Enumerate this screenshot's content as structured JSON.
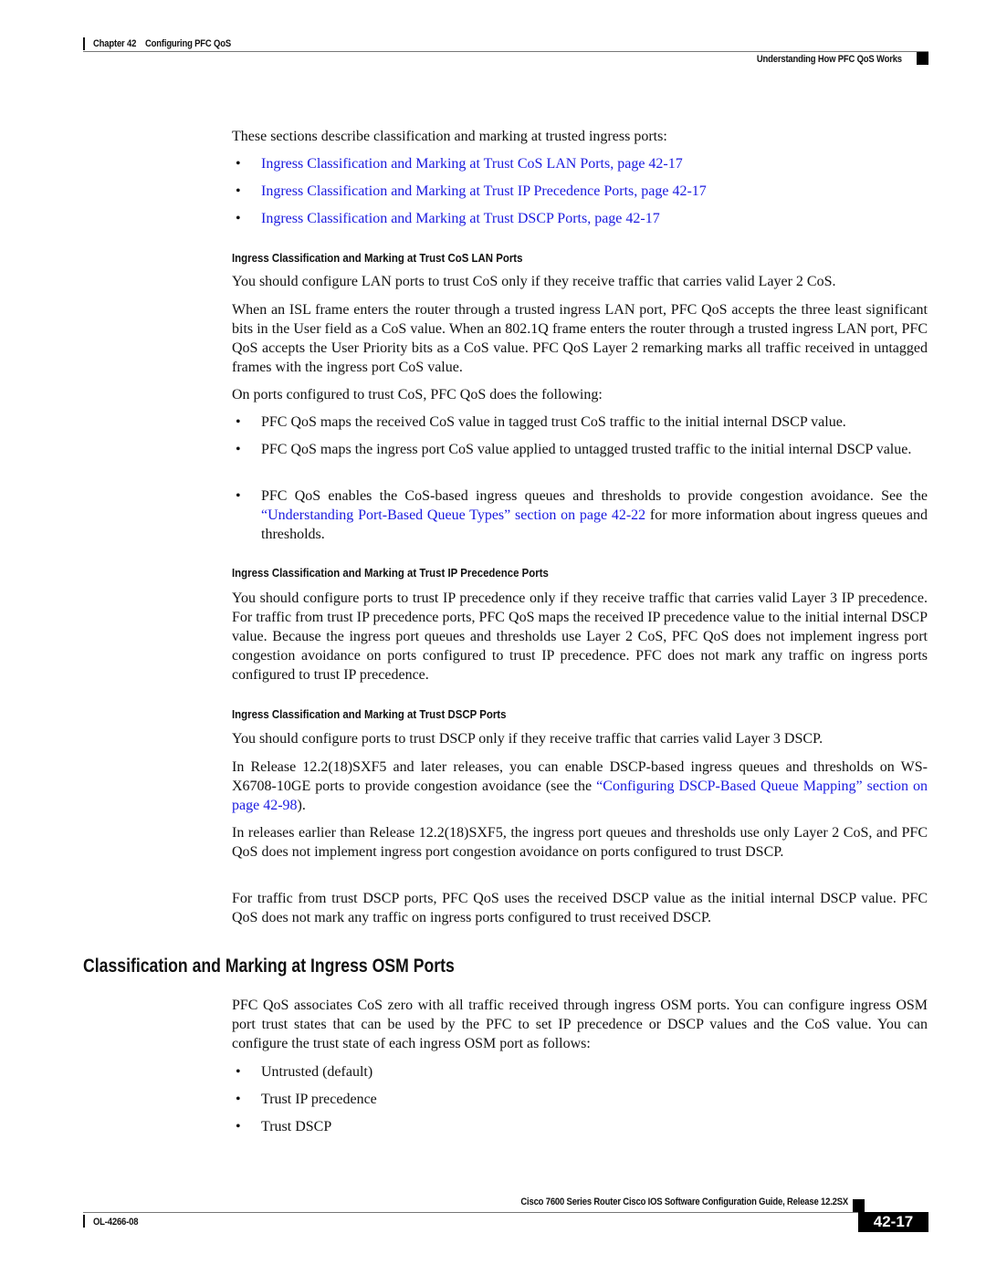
{
  "header": {
    "chapter": "Chapter 42",
    "chapter_title": "Configuring PFC QoS",
    "section": "Understanding How PFC QoS Works"
  },
  "intro": {
    "text": "These sections describe classification and marking at trusted ingress ports:",
    "links": [
      "Ingress Classification and Marking at Trust CoS LAN Ports, page 42-17",
      "Ingress Classification and Marking at Trust IP Precedence Ports, page 42-17",
      "Ingress Classification and Marking at Trust DSCP Ports, page 42-17"
    ]
  },
  "cos": {
    "heading": "Ingress Classification and Marking at Trust CoS LAN Ports",
    "p1": "You should configure LAN ports to trust CoS only if they receive traffic that carries valid Layer 2 CoS.",
    "p2": "When an ISL frame enters the router through a trusted ingress LAN port, PFC QoS accepts the three least significant bits in the User field as a CoS value. When an 802.1Q frame enters the router through a trusted ingress LAN port, PFC QoS accepts the User Priority bits as a CoS value. PFC QoS Layer 2 remarking marks all traffic received in untagged frames with the ingress port CoS value.",
    "p3": "On ports configured to trust CoS, PFC QoS does the following:",
    "bullets": [
      "PFC QoS maps the received CoS value in tagged trust CoS traffic to the initial internal DSCP value.",
      "PFC QoS maps the ingress port CoS value applied to untagged trusted traffic to the initial internal DSCP value."
    ],
    "bullet3_pre": "PFC QoS enables the CoS-based ingress queues and thresholds to provide congestion avoidance. See the ",
    "bullet3_link": "“Understanding Port-Based Queue Types” section on page 42-22",
    "bullet3_post": " for more information about ingress queues and thresholds."
  },
  "ipprec": {
    "heading": "Ingress Classification and Marking at Trust IP Precedence Ports",
    "p1": "You should configure ports to trust IP precedence only if they receive traffic that carries valid Layer 3 IP precedence. For traffic from trust IP precedence ports, PFC QoS maps the received IP precedence value to the initial internal DSCP value. Because the ingress port queues and thresholds use Layer 2 CoS, PFC QoS does not implement ingress port congestion avoidance on ports configured to trust IP precedence. PFC does not mark any traffic on ingress ports configured to trust IP precedence."
  },
  "dscp": {
    "heading": "Ingress Classification and Marking at Trust DSCP Ports",
    "p1": "You should configure ports to trust DSCP only if they receive traffic that carries valid Layer 3 DSCP.",
    "p2_pre": "In Release 12.2(18)SXF5 and later releases, you can enable DSCP-based ingress queues and thresholds on WS-X6708-10GE ports to provide congestion avoidance (see the ",
    "p2_link": "“Configuring DSCP-Based Queue Mapping” section on page 42-98",
    "p2_post": ").",
    "p3": "In releases earlier than Release 12.2(18)SXF5, the ingress port queues and thresholds use only Layer 2 CoS, and PFC QoS does not implement ingress port congestion avoidance on ports configured to trust DSCP.",
    "p4": "For traffic from trust DSCP ports, PFC QoS uses the received DSCP value as the initial internal DSCP value. PFC QoS does not mark any traffic on ingress ports configured to trust received DSCP."
  },
  "osm": {
    "heading": "Classification and Marking at Ingress OSM Ports",
    "p1": "PFC QoS associates CoS zero with all traffic received through ingress OSM ports. You can configure ingress OSM port trust states that can be used by the PFC to set IP precedence or DSCP values and the CoS value. You can configure the trust state of each ingress OSM port as follows:",
    "bullets": [
      "Untrusted (default)",
      "Trust IP precedence",
      "Trust DSCP"
    ]
  },
  "footer": {
    "guide_title": "Cisco 7600 Series Router Cisco IOS Software Configuration Guide, Release 12.2SX",
    "doc_id": "OL-4266-08",
    "page_number": "42-17"
  },
  "bullet_glyph": "•",
  "colors": {
    "link": "#1a1adf",
    "text": "#111111"
  }
}
